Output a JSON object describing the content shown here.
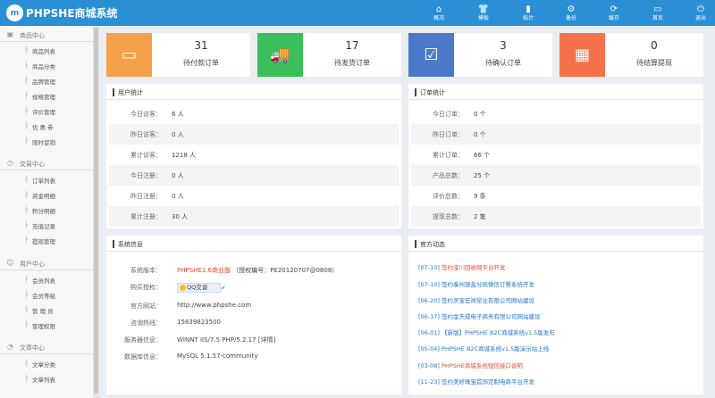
{
  "app": {
    "logo_mark": "m",
    "title": "PHPSHE商城系统"
  },
  "topnav": [
    {
      "label": "概况",
      "icon": "home-icon",
      "glyph": "⌂"
    },
    {
      "label": "模板",
      "icon": "shirt-icon",
      "glyph": "👕"
    },
    {
      "label": "统计",
      "icon": "bar-chart-icon",
      "glyph": "▮"
    },
    {
      "label": "备份",
      "icon": "gear-icon",
      "glyph": "⚙"
    },
    {
      "label": "缓存",
      "icon": "refresh-icon",
      "glyph": "⟳"
    },
    {
      "label": "首页",
      "icon": "monitor-icon",
      "glyph": "▭"
    },
    {
      "label": "退出",
      "icon": "power-icon",
      "glyph": "⏻"
    }
  ],
  "sidebar": {
    "groups": [
      {
        "label": "商品中心",
        "icon": "box-icon",
        "glyph": "▣",
        "items": [
          "商品列表",
          "商品分类",
          "品牌管理",
          "规格管理",
          "评价管理",
          "优 惠 券",
          "限时促销"
        ]
      },
      {
        "label": "交易中心",
        "icon": "trade-icon",
        "glyph": "◷",
        "items": [
          "订单列表",
          "资金明细",
          "积分明细",
          "充值记录",
          "提现管理"
        ]
      },
      {
        "label": "用户中心",
        "icon": "user-icon",
        "glyph": "☺",
        "items": [
          "会员列表",
          "会员等级",
          "管 理 员",
          "管理权限"
        ]
      },
      {
        "label": "文章中心",
        "icon": "article-icon",
        "glyph": "◔",
        "items": [
          "文章分类",
          "文章列表"
        ]
      }
    ],
    "bullet": "├"
  },
  "cards": [
    {
      "value": "31",
      "label": "待付款订单",
      "color": "#f5a049",
      "icon": "wallet-icon",
      "glyph": "▭"
    },
    {
      "value": "17",
      "label": "待发货订单",
      "color": "#3bbf5c",
      "icon": "truck-icon",
      "glyph": "🚚"
    },
    {
      "value": "3",
      "label": "待确认订单",
      "color": "#4c79c9",
      "icon": "checkbox-icon",
      "glyph": "☑"
    },
    {
      "value": "0",
      "label": "待结算提现",
      "color": "#f5714a",
      "icon": "calculator-icon",
      "glyph": "▦"
    }
  ],
  "user_stats": {
    "title": "用户统计",
    "rows": [
      {
        "k": "今日访客：",
        "v": "6 人"
      },
      {
        "k": "昨日访客：",
        "v": "0 人"
      },
      {
        "k": "累计访客：",
        "v": "1218 人"
      },
      {
        "k": "今日注册：",
        "v": "0 人"
      },
      {
        "k": "昨日注册：",
        "v": "0 人"
      },
      {
        "k": "累计注册：",
        "v": "30 人"
      }
    ]
  },
  "order_stats": {
    "title": "订单统计",
    "rows": [
      {
        "k": "今日订单：",
        "v": "0 个"
      },
      {
        "k": "昨日订单：",
        "v": "0 个"
      },
      {
        "k": "累计订单：",
        "v": "66 个"
      },
      {
        "k": "产品总数：",
        "v": "25 个"
      },
      {
        "k": "评价总数：",
        "v": "9 条"
      },
      {
        "k": "提现总数：",
        "v": "2 笔"
      }
    ]
  },
  "system_info": {
    "title": "系统信息",
    "version_key": "系统版本：",
    "version_value": "PHPSHE1.6商业版",
    "version_extra": "（授权编号：PE20120707@0808）",
    "license_key": "购买授权：",
    "qq_label": "QQ交谈",
    "site_key": "官方网站：",
    "site_value": "http://www.phpshe.com",
    "hotline_key": "咨询热线：",
    "hotline_value": "15839823500",
    "server_key": "服务器信息：",
    "server_value": "WINNT IIS/7.5 PHP/5.2.17 [详情]",
    "db_key": "数据库信息：",
    "db_value": "MySQL 5.1.57-community"
  },
  "news": {
    "title": "官方动态",
    "items": [
      {
        "date": "[07-10]",
        "text": "签约宝川回收网平台开发",
        "red": true
      },
      {
        "date": "[07-10]",
        "text": "签约泰州银盐分局微信订餐系统开发",
        "red": false
      },
      {
        "date": "[06-20]",
        "text": "签约灵宝宏祥窑业有限公司网站建设",
        "red": false
      },
      {
        "date": "[06-17]",
        "text": "签约金天成电子商务有限公司网站建设",
        "red": false
      },
      {
        "date": "[06-01]",
        "text": "【新版】PHPSHE B2C商城系统v1.5版发布",
        "red": false
      },
      {
        "date": "[05-04]",
        "text": "PHPSHE B2C商城系统v1.5版演示站上线",
        "red": false
      },
      {
        "date": "[03-08]",
        "text": "PHPSHE商城系统短信接口说明",
        "red": true
      },
      {
        "date": "[11-23]",
        "text": "签约美好珠宝首饰定制电商平台开发",
        "red": false
      }
    ]
  }
}
